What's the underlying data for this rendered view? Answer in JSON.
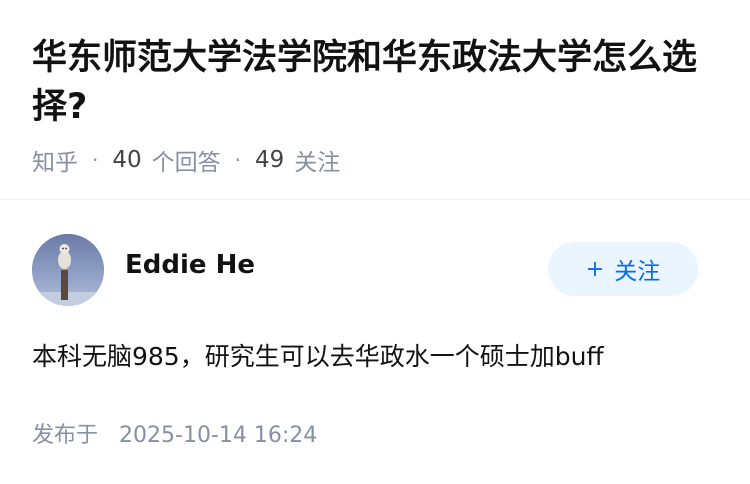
{
  "question": {
    "title": "华东师范大学法学院和华东政法大学怎么选择?",
    "meta": {
      "source": "知乎",
      "answers_count": "40",
      "answers_label": "个回答",
      "followers_count": "49",
      "followers_label": "关注",
      "separator": "·"
    }
  },
  "answer": {
    "author": {
      "name": "Eddie He",
      "avatar_icon": "snowy-owl-avatar"
    },
    "follow_button": {
      "plus": "+",
      "label": "关注"
    },
    "content": "本科无脑985，研究生可以去华政水一个硕士加buff",
    "publish": {
      "label": "发布于",
      "datetime": "2025-10-14 16:24"
    }
  },
  "colors": {
    "title": "#121212",
    "meta": "#8590a6",
    "follow_bg": "#ebf5ff",
    "follow_text": "#056de8"
  }
}
